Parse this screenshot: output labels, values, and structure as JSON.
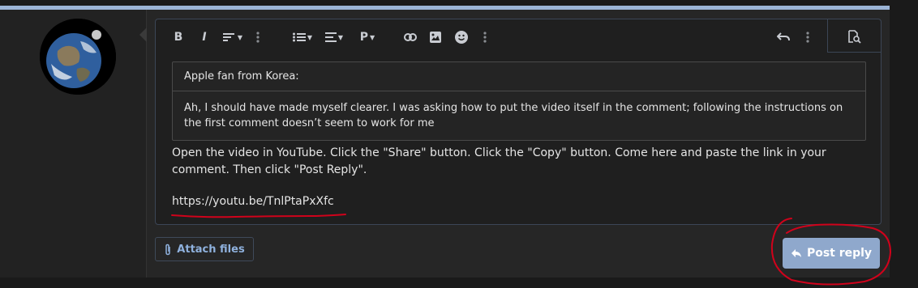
{
  "toolbar": {
    "buttons": [
      {
        "name": "bold-icon",
        "glyph": "B"
      },
      {
        "name": "italic-icon",
        "glyph": "I"
      }
    ],
    "paragraph_glyph": "P"
  },
  "quote": {
    "author": "Apple fan from Korea:",
    "text": "Ah, I should have made myself clearer. I was asking how to put the video itself in the comment; following the instructions on the first comment doesn’t seem to work for me"
  },
  "reply": {
    "text": "Open the video in YouTube. Click the \"Share\" button. Click the \"Copy\" button. Come here and paste the link in your comment. Then click \"Post Reply\".",
    "link": "https://youtu.be/TnlPtaPxXfc"
  },
  "actions": {
    "attach_label": "Attach files",
    "post_label": "Post reply"
  },
  "colors": {
    "accent": "#8fa8cc",
    "annotation": "#d0021b"
  }
}
